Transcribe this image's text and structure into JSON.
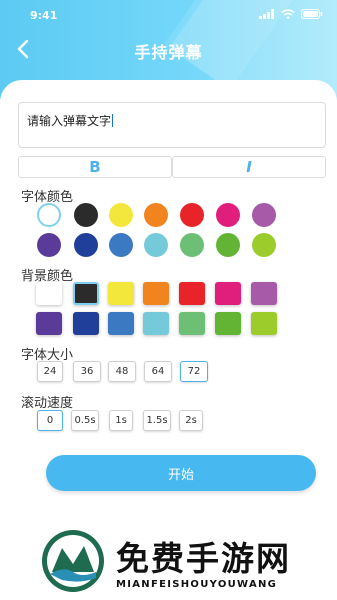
{
  "status": {
    "time": "9:41"
  },
  "header": {
    "title": "手持弹幕"
  },
  "input": {
    "value": "请输入弹幕文字"
  },
  "format": {
    "bold": "B",
    "italic": "I"
  },
  "font_color": {
    "label": "字体颜色",
    "colors": [
      "#ffffff",
      "#2b2b2b",
      "#f2e73a",
      "#f28420",
      "#e8242a",
      "#e01f7c",
      "#a65aa8",
      "#5a3b9a",
      "#1f3f9a",
      "#3b7ac2",
      "#74cad8",
      "#6cbf74",
      "#63b335",
      "#9bcc2c"
    ],
    "selected": 0
  },
  "bg_color": {
    "label": "背景颜色",
    "colors": [
      "#ffffff",
      "#2b2b2b",
      "#f2e73a",
      "#f28420",
      "#e8242a",
      "#e01f7c",
      "#a65aa8",
      "#5a3b9a",
      "#1f3f9a",
      "#3b7ac2",
      "#74cad8",
      "#6cbf74",
      "#63b335",
      "#9bcc2c"
    ],
    "selected": 1
  },
  "font_size": {
    "label": "字体大小",
    "options": [
      "24",
      "36",
      "48",
      "64",
      "72"
    ],
    "selected": "72"
  },
  "scroll_speed": {
    "label": "滚动速度",
    "options": [
      "0",
      "0.5s",
      "1s",
      "1.5s",
      "2s"
    ],
    "selected": "0"
  },
  "start_button": {
    "label": "开始"
  },
  "watermark": {
    "cn": "免费手游网",
    "en": "MIANFEISHOUYOUWANG"
  }
}
